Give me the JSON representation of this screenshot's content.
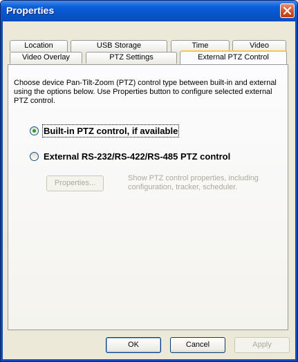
{
  "window": {
    "title": "Properties"
  },
  "tabs": {
    "row1": [
      "Location",
      "USB Storage",
      "Time",
      "Video"
    ],
    "row2": [
      "Video Overlay",
      "PTZ Settings",
      "External PTZ Control"
    ],
    "active": "External PTZ Control"
  },
  "panel": {
    "description": "Choose device Pan-Tilt-Zoom (PTZ) control type between built-in and external using the options below. Use Properties button to configure selected external PTZ control.",
    "option_builtin": "Built-in PTZ control, if available",
    "option_external": "External RS-232/RS-422/RS-485 PTZ control",
    "selected_option": "builtin",
    "properties_button": "Properties...",
    "properties_hint": "Show PTZ control properties, including configuration, tracker, scheduler."
  },
  "buttons": {
    "ok": "OK",
    "cancel": "Cancel",
    "apply": "Apply"
  },
  "colors": {
    "titlebar": "#0853c9",
    "tab_highlight": "#ffc83c",
    "radio_dot": "#21a121"
  }
}
